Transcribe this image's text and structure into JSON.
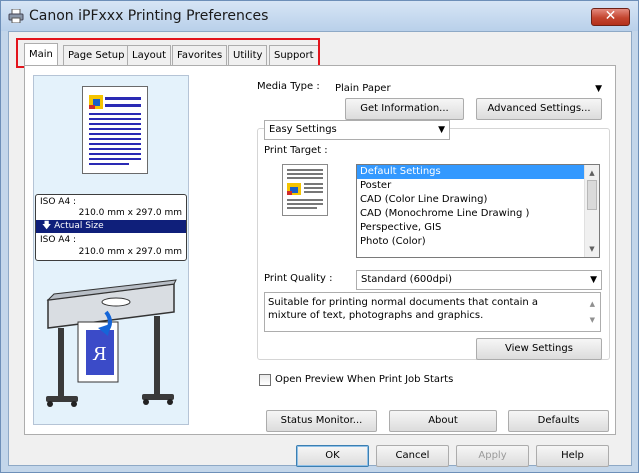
{
  "window": {
    "title": "Canon iPFxxx Printing Preferences",
    "close_label": "✕"
  },
  "tabs": [
    {
      "label": "Main",
      "active": true
    },
    {
      "label": "Page Setup"
    },
    {
      "label": "Layout"
    },
    {
      "label": "Favorites"
    },
    {
      "label": "Utility"
    },
    {
      "label": "Support"
    }
  ],
  "preview": {
    "page_size_label": "ISO A4 :",
    "page_size_value": "210.0 mm x 297.0 mm",
    "actual_size_label": "Actual Size",
    "output_size_label": "ISO A4 :",
    "output_size_value": "210.0 mm x 297.0 mm"
  },
  "media": {
    "label": "Media Type :",
    "value": "Plain Paper",
    "get_info_button": "Get Information...",
    "advanced_button": "Advanced Settings..."
  },
  "settings_mode": {
    "value": "Easy Settings"
  },
  "print_target": {
    "label": "Print Target :",
    "items": [
      "Default Settings",
      "Poster",
      "CAD (Color Line Drawing)",
      "CAD (Monochrome Line Drawing )",
      "Perspective, GIS",
      "Photo (Color)"
    ],
    "selected_index": 0
  },
  "print_quality": {
    "label": "Print Quality :",
    "value": "Standard (600dpi)",
    "description": "Suitable for printing normal documents that contain a mixture of text, photographs and graphics.",
    "view_settings_button": "View Settings"
  },
  "open_preview": {
    "label": "Open Preview When Print Job Starts",
    "checked": false
  },
  "footer_buttons": {
    "status_monitor": "Status Monitor...",
    "about": "About",
    "defaults": "Defaults"
  },
  "dialog_buttons": {
    "ok": "OK",
    "cancel": "Cancel",
    "apply": "Apply",
    "help": "Help"
  },
  "colors": {
    "tab_highlight": "#e3141c",
    "selection": "#3399ff",
    "actual_size_bar": "#0f1f7a",
    "preview_background": "#e4f2fb"
  }
}
